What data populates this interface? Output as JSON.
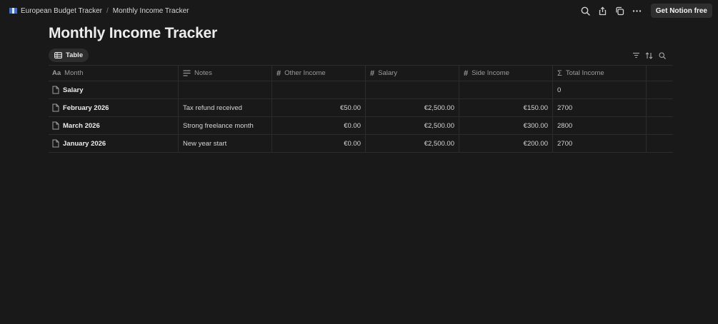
{
  "breadcrumb": {
    "items": [
      {
        "label": "European Budget Tracker"
      },
      {
        "label": "Monthly Income Tracker"
      }
    ],
    "separator": "/"
  },
  "topbar": {
    "cta_label": "Get Notion free",
    "icons": [
      "search-icon",
      "share-icon",
      "duplicate-icon",
      "more-icon"
    ]
  },
  "page": {
    "title": "Monthly Income Tracker"
  },
  "view": {
    "tab_label": "Table",
    "tools": [
      "filter-icon",
      "sort-icon",
      "search-icon"
    ]
  },
  "table": {
    "columns": [
      {
        "label": "Month",
        "icon": "Aa"
      },
      {
        "label": "Notes",
        "icon": "lines"
      },
      {
        "label": "Other Income",
        "icon": "#"
      },
      {
        "label": "Salary",
        "icon": "#"
      },
      {
        "label": "Side Income",
        "icon": "#"
      },
      {
        "label": "Total Income",
        "icon": "Σ"
      }
    ],
    "rows": [
      {
        "month": "Salary",
        "notes": "",
        "other": "",
        "salary": "",
        "side": "",
        "total": "0"
      },
      {
        "month": "February 2026",
        "notes": "Tax refund received",
        "other": "€50.00",
        "salary": "€2,500.00",
        "side": "€150.00",
        "total": "2700"
      },
      {
        "month": "March 2026",
        "notes": "Strong freelance month",
        "other": "€0.00",
        "salary": "€2,500.00",
        "side": "€300.00",
        "total": "2800"
      },
      {
        "month": "January 2026",
        "notes": "New year start",
        "other": "€0.00",
        "salary": "€2,500.00",
        "side": "€200.00",
        "total": "2700"
      }
    ]
  },
  "colors": {
    "background": "#191919",
    "text": "#d4d4d4",
    "muted": "#9b9b9b",
    "border": "#2c2c2c"
  }
}
